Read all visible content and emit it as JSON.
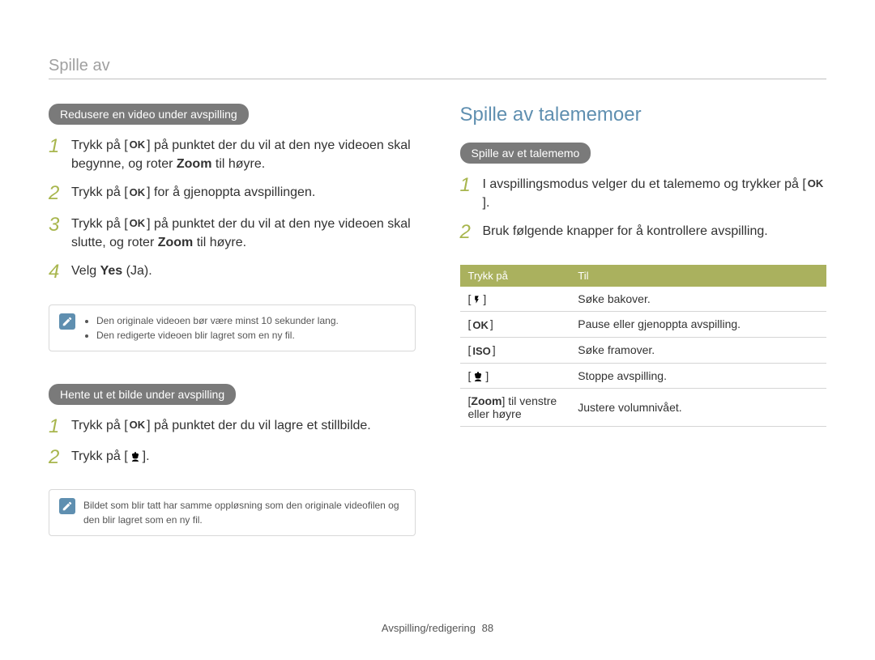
{
  "header": "Spille av",
  "left": {
    "section1": {
      "pill": "Redusere en video under avspilling",
      "steps": [
        {
          "n": "1",
          "pre": "Trykk på [",
          "key": "OK",
          "post": "] på punktet der du vil at den nye videoen skal begynne, og roter ",
          "bold": "Zoom",
          "tail": " til høyre."
        },
        {
          "n": "2",
          "pre": "Trykk på [",
          "key": "OK",
          "post": "] for å gjenoppta avspillingen."
        },
        {
          "n": "3",
          "pre": "Trykk på [",
          "key": "OK",
          "post": "] på punktet der du vil at den nye videoen skal slutte, og roter ",
          "bold": "Zoom",
          "tail": " til høyre."
        },
        {
          "n": "4",
          "plain_pre": "Velg ",
          "bold": "Yes",
          "tail": " (Ja)."
        }
      ],
      "note": [
        "Den originale videoen bør være minst 10 sekunder lang.",
        "Den redigerte videoen blir lagret som en ny fil."
      ]
    },
    "section2": {
      "pill": "Hente ut et bilde under avspilling",
      "steps": [
        {
          "n": "1",
          "pre": "Trykk på [",
          "key": "OK",
          "post": "] på punktet der du vil lagre et stillbilde."
        },
        {
          "n": "2",
          "pre": "Trykk på [",
          "icon": "flower",
          "post": "]."
        }
      ],
      "note_plain": "Bildet som blir tatt har samme oppløsning som den originale videofilen og den blir lagret som en ny fil."
    }
  },
  "right": {
    "title": "Spille av talememoer",
    "pill": "Spille av et talememo",
    "steps": [
      {
        "n": "1",
        "pre": "I avspillingsmodus velger du et talememo og trykker på [",
        "key": "OK",
        "post": "]."
      },
      {
        "n": "2",
        "plain": "Bruk følgende knapper for å kontrollere avspilling."
      }
    ],
    "table": {
      "headers": [
        "Trykk på",
        "Til"
      ],
      "rows": [
        {
          "k_icon": "flash",
          "k_pre": "[",
          "k_post": "]",
          "v": "Søke bakover."
        },
        {
          "k_text": "OK",
          "k_pre": "[",
          "k_post": "]",
          "v": "Pause eller gjenoppta avspilling."
        },
        {
          "k_text": "ISO",
          "k_pre": "[",
          "k_post": "]",
          "v": "Søke framover."
        },
        {
          "k_icon": "flower",
          "k_pre": "[",
          "k_post": "]",
          "v": "Stoppe avspilling."
        },
        {
          "k_plain_pre": "[",
          "k_bold": "Zoom",
          "k_plain_post": "] til venstre eller høyre",
          "v": "Justere volumnivået."
        }
      ]
    }
  },
  "footer": {
    "section": "Avspilling/redigering",
    "page": "88"
  }
}
